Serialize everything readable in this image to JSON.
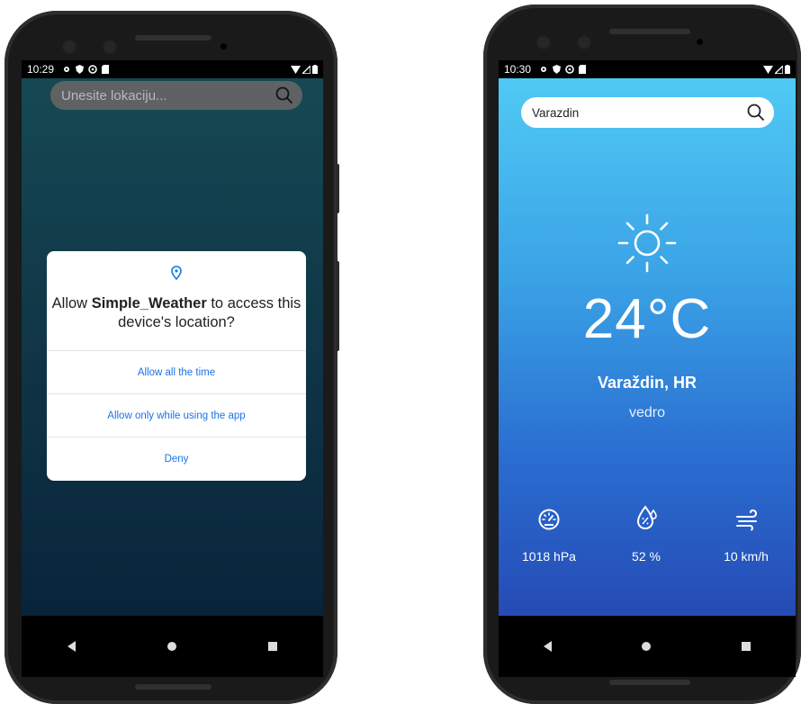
{
  "left_phone": {
    "status_time": "10:29",
    "search": {
      "placeholder": "Unesite lokaciju..."
    },
    "dialog": {
      "question_prefix": "Allow ",
      "app_name": "Simple_Weather",
      "question_suffix": " to access this device's location?",
      "options": [
        "Allow all the time",
        "Allow only while using the app",
        "Deny"
      ]
    }
  },
  "right_phone": {
    "status_time": "10:30",
    "search": {
      "value": "Varazdin"
    },
    "weather": {
      "icon": "sun-icon",
      "temperature": "24°C",
      "city": "Varaždin, HR",
      "description": "vedro"
    },
    "stats": [
      {
        "icon": "pressure-gauge-icon",
        "value": "1018 hPa"
      },
      {
        "icon": "humidity-icon",
        "value": "52 %"
      },
      {
        "icon": "wind-icon",
        "value": "10 km/h"
      }
    ]
  },
  "colors": {
    "dialog_accent": "#1a73e8",
    "right_gradient_top": "#52cdf6",
    "right_gradient_bottom": "#233ea9"
  }
}
